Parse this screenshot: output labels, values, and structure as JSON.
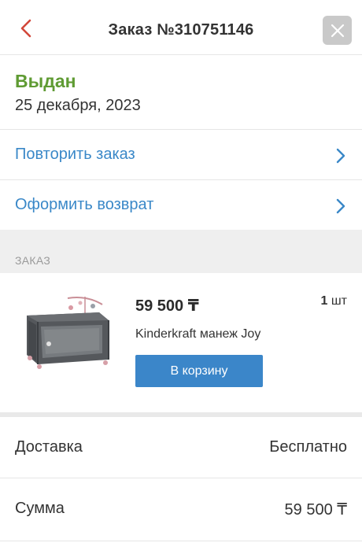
{
  "header": {
    "title": "Заказ №310751146",
    "back_icon": "chevron-left-icon",
    "close_icon": "close-icon",
    "accent_color": "#d2473a"
  },
  "status": {
    "label": "Выдан",
    "date": "25 декабря, 2023",
    "color": "#5f9b33"
  },
  "actions": [
    {
      "label": "Повторить заказ",
      "icon": "chevron-right-icon"
    },
    {
      "label": "Оформить возврат",
      "icon": "chevron-right-icon"
    }
  ],
  "order_section": {
    "title": "ЗАКАЗ"
  },
  "product": {
    "price": "59 500 ₸",
    "qty_number": "1",
    "qty_unit": "шт",
    "name": "Kinderkraft манеж Joy",
    "cart_button": "В корзину",
    "button_color": "#3b86c9"
  },
  "summary": {
    "delivery_label": "Доставка",
    "delivery_value": "Бесплатно",
    "total_label": "Сумма",
    "total_value": "59 500 ₸"
  }
}
